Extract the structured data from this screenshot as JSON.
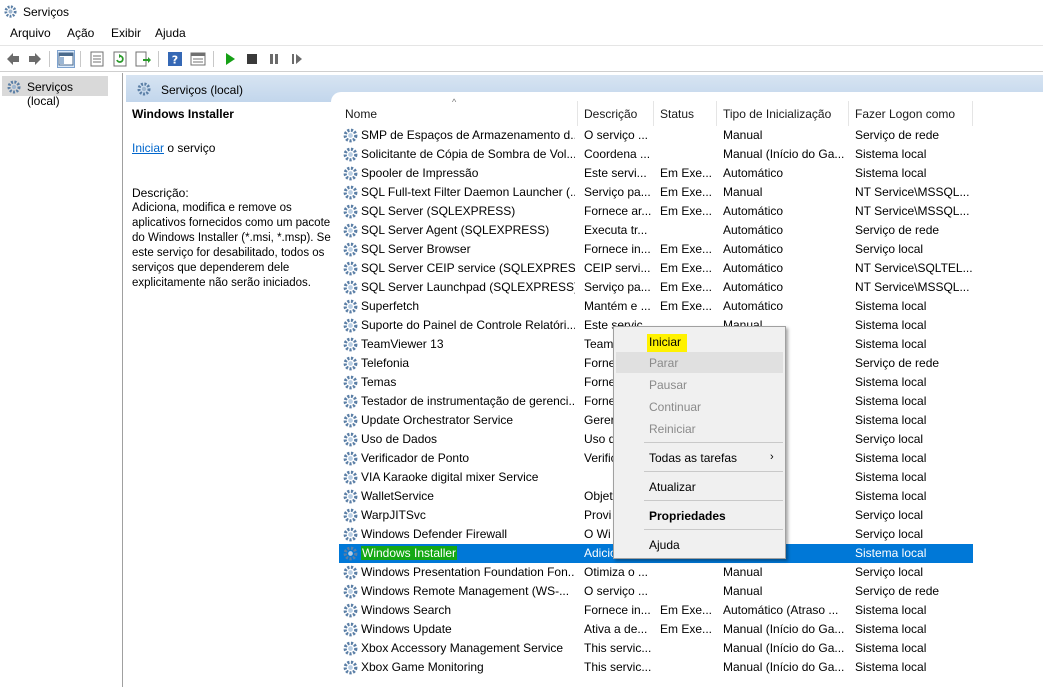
{
  "window": {
    "title": "Serviços"
  },
  "menu": [
    "Arquivo",
    "Ação",
    "Exibir",
    "Ajuda"
  ],
  "tree": {
    "root_label": "Serviços (local)"
  },
  "panel": {
    "header": "Serviços (local)"
  },
  "details": {
    "service_name": "Windows Installer",
    "action_link": "Iniciar",
    "action_suffix": " o serviço",
    "desc_label": "Descrição:",
    "desc_text": "Adiciona, modifica e remove os aplicativos fornecidos como um pacote do Windows Installer (*.msi, *.msp). Se este serviço for desabilitado, todos os serviços que dependerem dele explicitamente não serão iniciados."
  },
  "columns": [
    "Nome",
    "Descrição",
    "Status",
    "Tipo de Inicialização",
    "Fazer Logon como"
  ],
  "selected_index": 22,
  "services": [
    {
      "name": "SMP de Espaços de Armazenamento d...",
      "desc": "O serviço ...",
      "status": "",
      "startup": "Manual",
      "logon": "Serviço de rede"
    },
    {
      "name": "Solicitante de Cópia de Sombra de Vol...",
      "desc": "Coordena ...",
      "status": "",
      "startup": "Manual (Início do Ga...",
      "logon": "Sistema local"
    },
    {
      "name": "Spooler de Impressão",
      "desc": "Este servi...",
      "status": "Em Exe...",
      "startup": "Automático",
      "logon": "Sistema local"
    },
    {
      "name": "SQL Full-text Filter Daemon Launcher (...",
      "desc": "Serviço pa...",
      "status": "Em Exe...",
      "startup": "Manual",
      "logon": "NT Service\\MSSQL..."
    },
    {
      "name": "SQL Server (SQLEXPRESS)",
      "desc": "Fornece ar...",
      "status": "Em Exe...",
      "startup": "Automático",
      "logon": "NT Service\\MSSQL..."
    },
    {
      "name": "SQL Server Agent (SQLEXPRESS)",
      "desc": "Executa tr...",
      "status": "",
      "startup": "Automático",
      "logon": "Serviço de rede"
    },
    {
      "name": "SQL Server Browser",
      "desc": "Fornece in...",
      "status": "Em Exe...",
      "startup": "Automático",
      "logon": "Serviço local"
    },
    {
      "name": "SQL Server CEIP service (SQLEXPRESS)",
      "desc": "CEIP servi...",
      "status": "Em Exe...",
      "startup": "Automático",
      "logon": "NT Service\\SQLTEL..."
    },
    {
      "name": "SQL Server Launchpad (SQLEXPRESS)",
      "desc": "Serviço pa...",
      "status": "Em Exe...",
      "startup": "Automático",
      "logon": "NT Service\\MSSQL..."
    },
    {
      "name": "Superfetch",
      "desc": "Mantém e ...",
      "status": "Em Exe...",
      "startup": "Automático",
      "logon": "Sistema local"
    },
    {
      "name": "Suporte do Painel de Controle Relatóri...",
      "desc": "Este servic...",
      "status": "",
      "startup": "Manual",
      "logon": "Sistema local"
    },
    {
      "name": "TeamViewer 13",
      "desc": "Team",
      "status": "",
      "startup": "",
      "logon": "Sistema local"
    },
    {
      "name": "Telefonia",
      "desc": "Forne",
      "status": "",
      "startup": "",
      "logon": "Serviço de rede"
    },
    {
      "name": "Temas",
      "desc": "Forne",
      "status": "",
      "startup": "",
      "logon": "Sistema local"
    },
    {
      "name": "Testador de instrumentação de gerenci...",
      "desc": "Forne",
      "status": "",
      "startup": "",
      "logon": "Sistema local"
    },
    {
      "name": "Update Orchestrator Service",
      "desc": "Gerer",
      "status": "",
      "startup": "",
      "logon": "Sistema local"
    },
    {
      "name": "Uso de Dados",
      "desc": "Uso d",
      "status": "",
      "startup": "",
      "logon": "Serviço local"
    },
    {
      "name": "Verificador de Ponto",
      "desc": "Verific",
      "status": "",
      "startup": "io do Ga...",
      "logon": "Sistema local"
    },
    {
      "name": "VIA Karaoke digital mixer Service",
      "desc": "",
      "status": "",
      "startup": "",
      "logon": "Sistema local"
    },
    {
      "name": "WalletService",
      "desc": "Objet",
      "status": "",
      "startup": "",
      "logon": "Sistema local"
    },
    {
      "name": "WarpJITSvc",
      "desc": "Provi",
      "status": "",
      "startup": "io do Ga...",
      "logon": "Serviço local"
    },
    {
      "name": "Windows Defender Firewall",
      "desc": "O Wi",
      "status": "",
      "startup": "",
      "logon": "Serviço local"
    },
    {
      "name": "Windows Installer",
      "desc": "Adicio",
      "status": "",
      "startup": "",
      "logon": "Sistema local"
    },
    {
      "name": "Windows Presentation Foundation Fon...",
      "desc": "Otimiza o ...",
      "status": "",
      "startup": "Manual",
      "logon": "Serviço local"
    },
    {
      "name": "Windows Remote Management (WS-...",
      "desc": "O serviço ...",
      "status": "",
      "startup": "Manual",
      "logon": "Serviço de rede"
    },
    {
      "name": "Windows Search",
      "desc": "Fornece in...",
      "status": "Em Exe...",
      "startup": "Automático (Atraso ...",
      "logon": "Sistema local"
    },
    {
      "name": "Windows Update",
      "desc": "Ativa a de...",
      "status": "Em Exe...",
      "startup": "Manual (Início do Ga...",
      "logon": "Sistema local"
    },
    {
      "name": "Xbox Accessory Management Service",
      "desc": "This servic...",
      "status": "",
      "startup": "Manual (Início do Ga...",
      "logon": "Sistema local"
    },
    {
      "name": "Xbox Game Monitoring",
      "desc": "This servic...",
      "status": "",
      "startup": "Manual (Início do Ga...",
      "logon": "Sistema local"
    }
  ],
  "context_menu": {
    "items": [
      {
        "label": "Iniciar",
        "enabled": true,
        "highlighted": true
      },
      {
        "label": "Parar",
        "enabled": false
      },
      {
        "label": "Pausar",
        "enabled": false
      },
      {
        "label": "Continuar",
        "enabled": false
      },
      {
        "label": "Reiniciar",
        "enabled": false
      },
      {
        "label": "Todas as tarefas",
        "enabled": true,
        "submenu": true
      },
      {
        "label": "Atualizar",
        "enabled": true
      },
      {
        "label": "Propriedades",
        "enabled": true,
        "bold": true
      },
      {
        "label": "Ajuda",
        "enabled": true
      }
    ],
    "submenu_arrow": "›"
  },
  "colors": {
    "selection": "#0078d7",
    "highlight_yellow": "#fff200",
    "highlight_green": "#14a814"
  },
  "toolbar_icons": [
    "back-arrow-icon",
    "forward-arrow-icon",
    "show-hide-tree-icon",
    "properties-icon",
    "refresh-icon",
    "export-list-icon",
    "help-icon",
    "console-view-icon",
    "start-service-icon",
    "stop-service-icon",
    "pause-service-icon",
    "restart-service-icon"
  ]
}
